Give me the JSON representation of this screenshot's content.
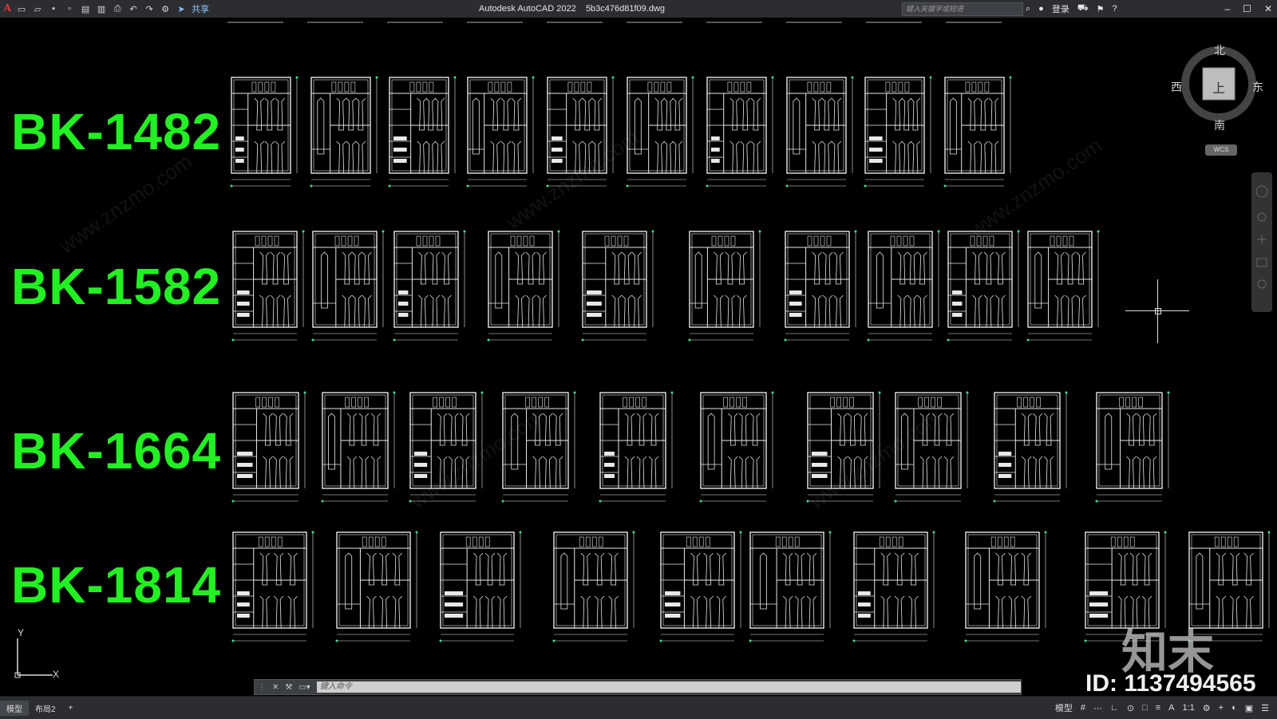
{
  "app": {
    "logo": "A",
    "title": "Autodesk AutoCAD 2022",
    "filename": "5b3c476d81f09.dwg",
    "share_label": "共享",
    "search_placeholder": "键入关键字或短语",
    "login_label": "登录"
  },
  "labels": [
    "BK-1482",
    "BK-1582",
    "BK-1664",
    "BK-1814"
  ],
  "viewcube": {
    "north": "北",
    "south": "南",
    "east": "东",
    "west": "西",
    "face": "上",
    "wcs": "WCS"
  },
  "ucs": {
    "x": "X",
    "y": "Y"
  },
  "command": {
    "placeholder": "键入命令"
  },
  "layout_tabs": [
    "模型",
    "布局2"
  ],
  "status": {
    "model": "模型",
    "scale": "1:1"
  },
  "watermark": {
    "brand": "知末",
    "id": "ID: 1137494565",
    "site": "www.znzmo.com"
  },
  "colors": {
    "label_green": "#22f022",
    "background": "#000000",
    "lines": "#e8e8e8",
    "dim_green": "#3fe08a"
  }
}
